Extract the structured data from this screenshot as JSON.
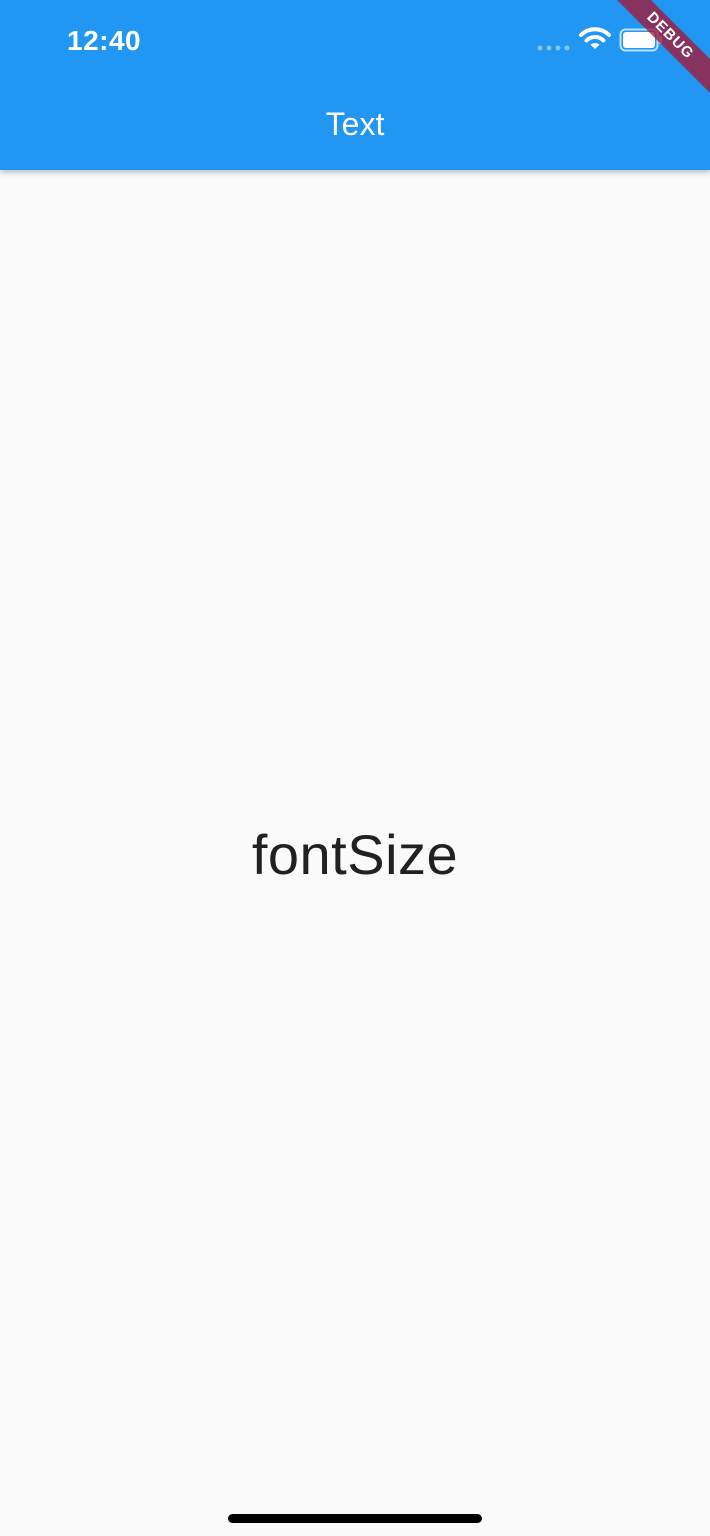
{
  "status_bar": {
    "time": "12:40",
    "icons": [
      "signal-icon",
      "wifi-icon",
      "battery-icon"
    ]
  },
  "app_bar": {
    "title": "Text",
    "background_color": "#2196F3",
    "text_color": "#FFFFFF"
  },
  "debug_banner": {
    "label": "DEBUG",
    "color": "#A31736"
  },
  "content": {
    "text": "fontSize",
    "text_color": "#212121",
    "background_color": "#FAFAFA"
  },
  "home_indicator": {
    "icon": "home-indicator"
  }
}
